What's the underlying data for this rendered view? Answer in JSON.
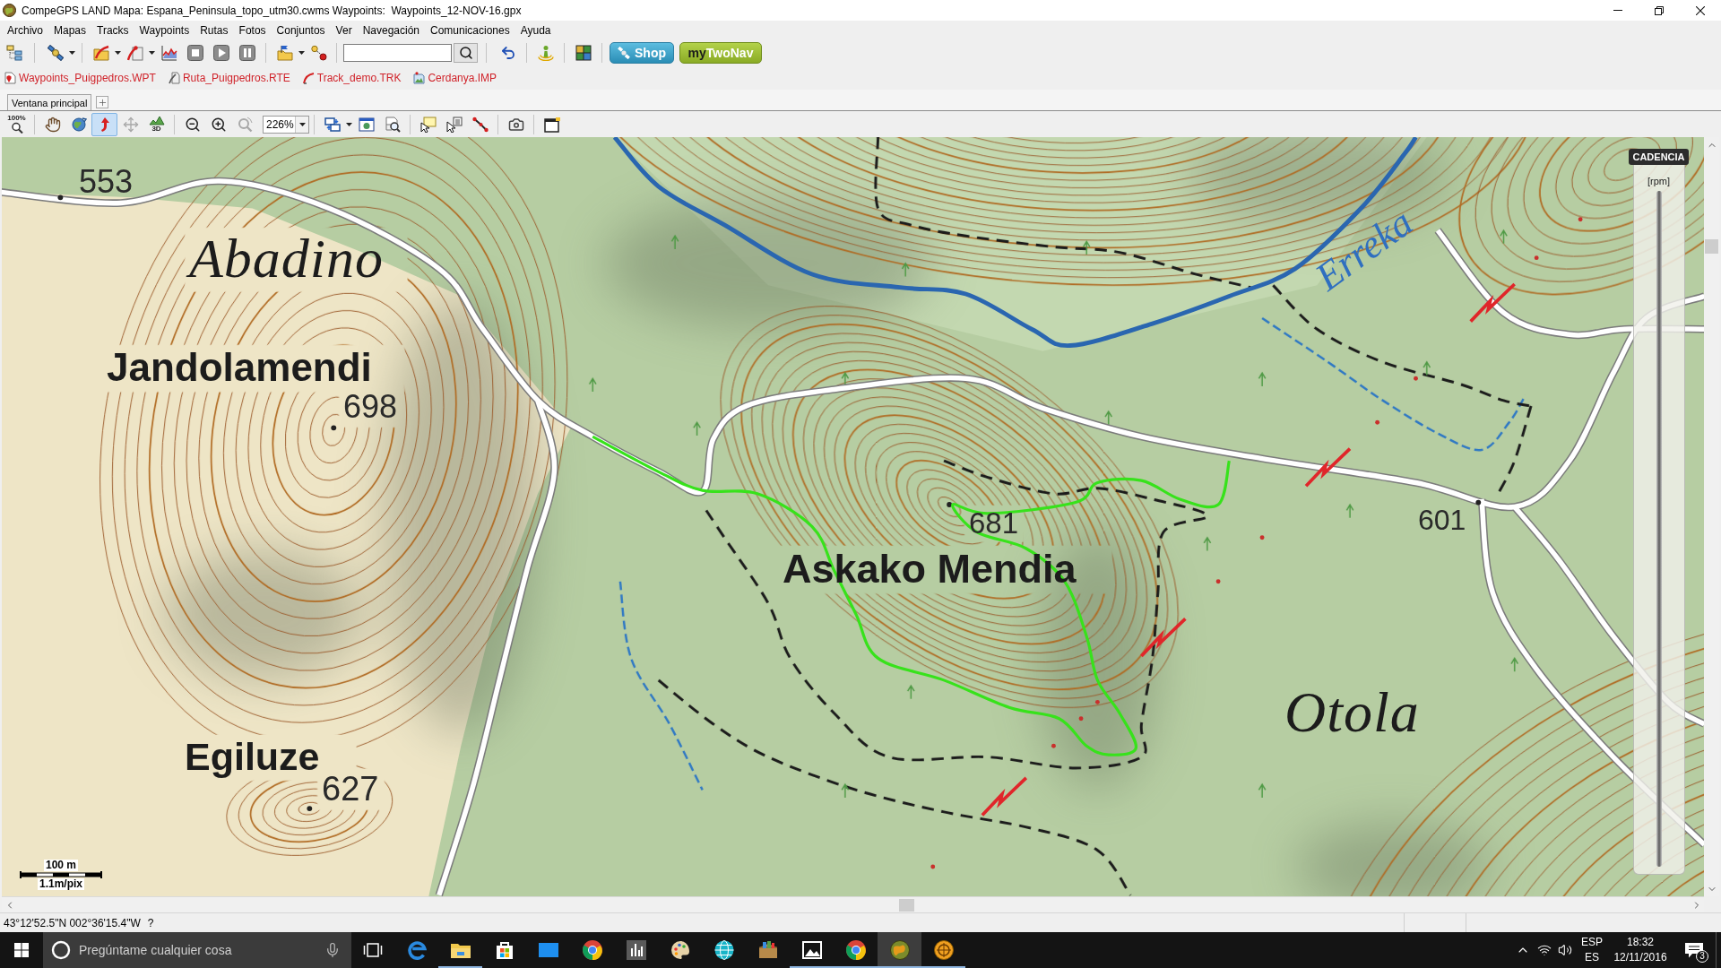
{
  "window": {
    "title": "CompeGPS LAND Mapa: Espana_Peninsula_topo_utm30.cwms Waypoints:  Waypoints_12-NOV-16.gpx"
  },
  "menu": [
    "Archivo",
    "Mapas",
    "Tracks",
    "Waypoints",
    "Rutas",
    "Fotos",
    "Conjuntos",
    "Ver",
    "Navegación",
    "Comunicaciones",
    "Ayuda"
  ],
  "toolbar": {
    "shop_button": "Shop",
    "twonav_button": [
      "my",
      "TwoNav"
    ]
  },
  "open_files": [
    {
      "name": "Waypoints_Puigpedros.WPT",
      "kind": "waypoints"
    },
    {
      "name": "Ruta_Puigpedros.RTE",
      "kind": "route"
    },
    {
      "name": "Track_demo.TRK",
      "kind": "track"
    },
    {
      "name": "Cerdanya.IMP",
      "kind": "image"
    }
  ],
  "tabs": [
    {
      "label": "Ventana principal",
      "selected": true
    }
  ],
  "map_toolbar": {
    "zoom_reset": "100%",
    "tools": [
      {
        "kind": "pan",
        "selected": false
      },
      {
        "kind": "rotate",
        "selected": false
      },
      {
        "kind": "track-pointer",
        "selected": true
      },
      {
        "kind": "move",
        "selected": false
      },
      {
        "kind": "view-3d",
        "label": "3D",
        "selected": false
      }
    ],
    "zoom_level": "226%"
  },
  "map": {
    "labels": [
      {
        "text": "553",
        "kind": "elevation"
      },
      {
        "text": "Abadino",
        "kind": "town"
      },
      {
        "text": "Jandolamendi",
        "kind": "peak"
      },
      {
        "text": "698",
        "kind": "elevation"
      },
      {
        "text": "Erreka",
        "kind": "water"
      },
      {
        "text": "681",
        "kind": "elevation"
      },
      {
        "text": "Askako Mendia",
        "kind": "peak"
      },
      {
        "text": "601",
        "kind": "elevation"
      },
      {
        "text": "Otola",
        "kind": "town"
      },
      {
        "text": "Egiluze",
        "kind": "peak"
      },
      {
        "text": "627",
        "kind": "elevation"
      }
    ],
    "scale": {
      "distance": "100 m",
      "resolution": "1.1m/pix"
    },
    "gauge": {
      "title": "CADENCIA",
      "unit": "[rpm]"
    }
  },
  "status_bar": {
    "coordinates": "43°12'52.5\"N 002°36'15.4\"W",
    "help": "?"
  },
  "taskbar": {
    "search": {
      "placeholder": "Pregúntame cualquier cosa"
    },
    "apps": [
      {
        "kind": "edge",
        "running": false,
        "active": false
      },
      {
        "kind": "file-explorer",
        "running": true,
        "active": false
      },
      {
        "kind": "store",
        "running": false,
        "active": false
      },
      {
        "kind": "mail",
        "running": false,
        "active": false
      },
      {
        "kind": "chrome",
        "running": false,
        "active": false
      },
      {
        "kind": "stats",
        "running": false,
        "active": false
      },
      {
        "kind": "paint",
        "running": false,
        "active": false
      },
      {
        "kind": "globe",
        "running": false,
        "active": false
      },
      {
        "kind": "package",
        "running": false,
        "active": false
      },
      {
        "kind": "photos",
        "running": true,
        "active": false
      },
      {
        "kind": "chrome",
        "running": true,
        "active": false
      },
      {
        "kind": "compegps",
        "running": true,
        "active": true
      },
      {
        "kind": "compass",
        "running": true,
        "active": false
      }
    ],
    "language": "ESP",
    "keyboard": "ES",
    "time": "18:32",
    "date": "12/11/2016",
    "notifications": "3"
  }
}
